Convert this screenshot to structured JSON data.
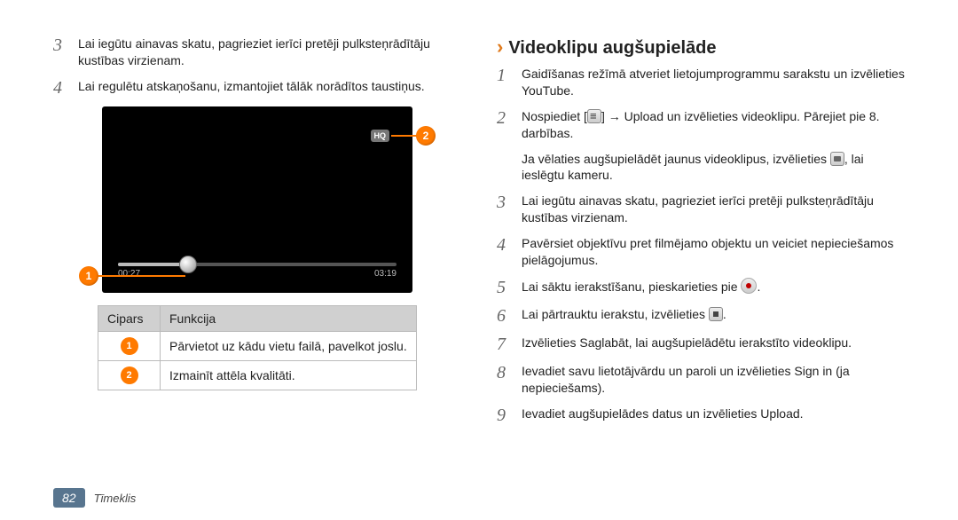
{
  "left": {
    "step3": "Lai iegūtu ainavas skatu, pagrieziet ierīci pretēji pulksteņrādītāju kustības virzienam.",
    "step4": "Lai regulētu atskaņošanu, izmantojiet tālāk norādītos taustiņus.",
    "screenshot": {
      "hq": "HQ",
      "time_start": "00:27",
      "time_end": "03:19"
    },
    "table": {
      "head_num": "Cipars",
      "head_func": "Funkcija",
      "row1": "Pārvietot uz kādu vietu failā, pavelkot joslu.",
      "row2": "Izmainīt attēla kvalitāti."
    }
  },
  "right": {
    "heading": "Videoklipu augšupielāde",
    "step1_a": "Gaidīšanas režīmā atveriet lietojumprogrammu sarakstu un izvēlieties ",
    "step1_app": "YouTube",
    "step1_b": ".",
    "step2_a": "Nospiediet [",
    "step2_b": "] → ",
    "step2_app": "Upload",
    "step2_c": " un izvēlieties videoklipu. Pārejiet pie 8. darbības.",
    "step2_extra_a": "Ja vēlaties augšupielādēt jaunus videoklipus, izvēlieties ",
    "step2_extra_b": ", lai ieslēgtu kameru.",
    "step3": "Lai iegūtu ainavas skatu, pagrieziet ierīci pretēji pulksteņrādītāju kustības virzienam.",
    "step4": "Pavērsiet objektīvu pret filmējamo objektu un veiciet nepieciešamos pielāgojumus.",
    "step5_a": "Lai sāktu ierakstīšanu, pieskarieties pie ",
    "step5_b": ".",
    "step6_a": "Lai pārtrauktu ierakstu, izvēlieties ",
    "step6_b": ".",
    "step7_a": "Izvēlieties ",
    "step7_app": "Saglabāt",
    "step7_b": ", lai augšupielādētu ierakstīto videoklipu.",
    "step8_a": "Ievadiet savu lietotājvārdu un paroli un izvēlieties ",
    "step8_app": "Sign in",
    "step8_b": " (ja nepieciešams).",
    "step9_a": "Ievadiet augšupielādes datus un izvēlieties ",
    "step9_app": "Upload",
    "step9_b": "."
  },
  "footer": {
    "page": "82",
    "section": "Tīmeklis"
  }
}
